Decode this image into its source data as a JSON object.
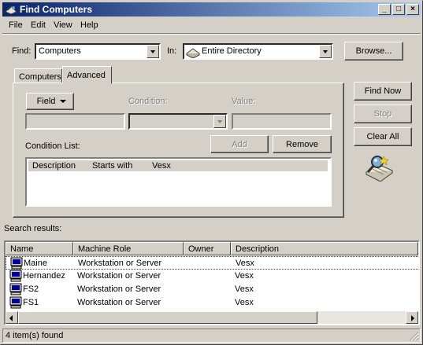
{
  "window": {
    "title": "Find Computers",
    "minimize_glyph": "_",
    "maximize_glyph": "□",
    "close_glyph": "×"
  },
  "menu": {
    "items": [
      "File",
      "Edit",
      "View",
      "Help"
    ]
  },
  "find_row": {
    "find_label": "Find:",
    "find_value": "Computers",
    "in_label": "In:",
    "in_value": "Entire Directory",
    "browse_label": "Browse..."
  },
  "tabs": [
    {
      "label": "Computers"
    },
    {
      "label": "Advanced"
    }
  ],
  "advanced": {
    "field_button": "Field",
    "condition_label": "Condition:",
    "value_label": "Value:",
    "add_button": "Add",
    "remove_button": "Remove",
    "condition_list_label": "Condition List:",
    "condition_list": [
      {
        "description": "Description",
        "condition": "Starts with",
        "value": "Vesx"
      }
    ]
  },
  "side_buttons": {
    "find_now": "Find Now",
    "stop": "Stop",
    "clear_all": "Clear All",
    "search_icon": "magnifier-search-icon"
  },
  "search_results": {
    "label": "Search results:",
    "columns": [
      "Name",
      "Machine Role",
      "Owner",
      "Description"
    ],
    "rows": [
      {
        "name": "Maine",
        "role": "Workstation or Server",
        "owner": "",
        "description": "Vesx"
      },
      {
        "name": "Hernandez",
        "role": "Workstation or Server",
        "owner": "",
        "description": "Vesx"
      },
      {
        "name": "FS2",
        "role": "Workstation or Server",
        "owner": "",
        "description": "Vesx"
      },
      {
        "name": "FS1",
        "role": "Workstation or Server",
        "owner": "",
        "description": "Vesx"
      }
    ]
  },
  "status": {
    "text": "4 item(s) found"
  },
  "colors": {
    "title_start": "#0a246a",
    "title_end": "#a6caf0",
    "face": "#d4d0c8"
  }
}
